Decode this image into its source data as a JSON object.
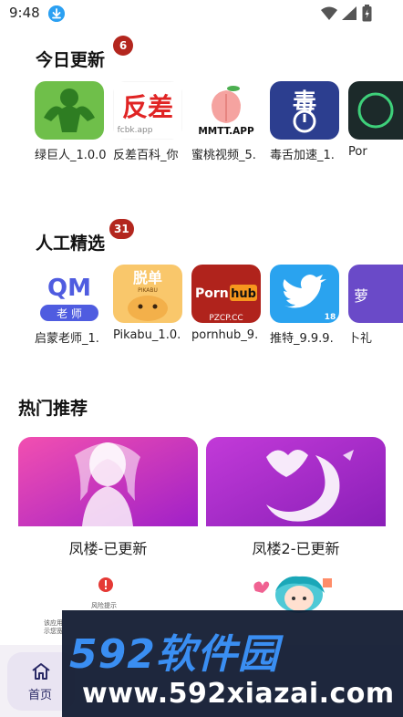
{
  "status_bar": {
    "time": "9:48",
    "icons": [
      "download-icon",
      "wifi-icon",
      "signal-icon",
      "battery-icon"
    ]
  },
  "today_updates": {
    "title": "今日更新",
    "badge": "6",
    "apps": [
      {
        "name": "绿巨人_1.0.0",
        "icon": "green-hulk-icon",
        "icon_text": "绿巨人"
      },
      {
        "name": "反差百科_你",
        "icon": "fancha-icon",
        "icon_text": "反差",
        "icon_subtext": "fcbk.app"
      },
      {
        "name": "蜜桃视频_5.",
        "icon": "peach-icon",
        "icon_text": "MMTT.APP"
      },
      {
        "name": "毒舌加速_1.",
        "icon": "dushe-icon",
        "icon_text": "毒"
      },
      {
        "name": "Por",
        "icon": "dark-app-icon"
      }
    ]
  },
  "manual_picks": {
    "title": "人工精选",
    "badge": "31",
    "apps": [
      {
        "name": "启蒙老师_1.",
        "icon": "qm-teacher-icon",
        "icon_text": "QM",
        "icon_subtext": "老 师"
      },
      {
        "name": "Pikabu_1.0.",
        "icon": "pikabu-icon",
        "icon_text": "脱单",
        "icon_subtext": "PIKABU"
      },
      {
        "name": "pornhub_9.",
        "icon": "ph-icon",
        "icon_text": "Porn",
        "icon_text2": "hub",
        "icon_subtext": "PZCP.CC"
      },
      {
        "name": "推特_9.9.9.",
        "icon": "twitter-icon",
        "icon_subtext": "18"
      },
      {
        "name": "卜礼",
        "icon": "purple-app-icon",
        "icon_text": "萝"
      }
    ]
  },
  "hot": {
    "title": "热门推荐",
    "items": [
      {
        "label": "凤楼-已更新",
        "icon": "fenglou-icon"
      },
      {
        "label": "凤楼2-已更新",
        "icon": "fenglou2-icon"
      }
    ],
    "promo_left": {
      "alert_title": "风险提示",
      "line1": "该应用",
      "line2": "示您宽"
    },
    "promo_right": {
      "icon": "anime-girl-icon"
    }
  },
  "bottom_nav": {
    "home_label": "首页"
  },
  "watermark": {
    "logo": "592软件园",
    "url": "www.592xiazai.com"
  },
  "colors": {
    "badge": "#b3261e",
    "nav_bg": "#f3f0f6",
    "accent_blue": "#3a8ef2"
  }
}
